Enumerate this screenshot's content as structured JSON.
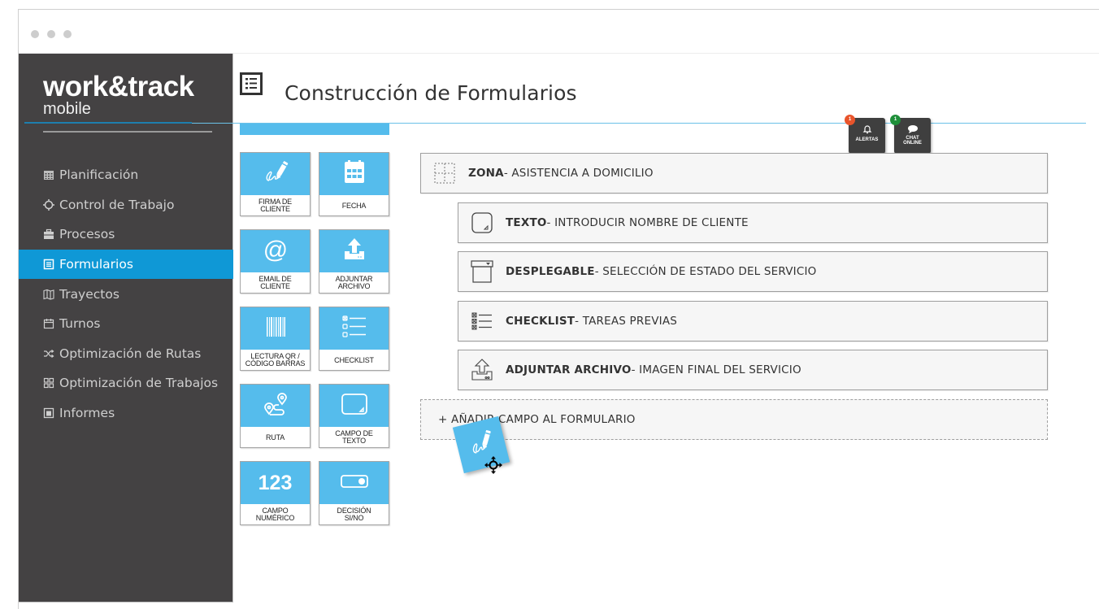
{
  "app": {
    "logo_main": "work&track",
    "logo_sub": "mobile"
  },
  "sidebar": {
    "items": [
      {
        "label": "Planificación",
        "icon": "calendar-grid-icon",
        "active": false
      },
      {
        "label": "Control de Trabajo",
        "icon": "crosshair-icon",
        "active": false
      },
      {
        "label": "Procesos",
        "icon": "briefcase-icon",
        "active": false
      },
      {
        "label": "Formularios",
        "icon": "form-list-icon",
        "active": true
      },
      {
        "label": "Trayectos",
        "icon": "map-icon",
        "active": false
      },
      {
        "label": "Turnos",
        "icon": "calendar-icon",
        "active": false
      },
      {
        "label": "Optimización de Rutas",
        "icon": "shuffle-icon",
        "active": false
      },
      {
        "label": "Optimización de Trabajos",
        "icon": "grid-icon",
        "active": false
      },
      {
        "label": "Informes",
        "icon": "report-icon",
        "active": false
      }
    ]
  },
  "header": {
    "title": "Construcción de Formularios",
    "icon": "form-list-icon"
  },
  "notifications": {
    "alerts": {
      "label": "ALERTAS",
      "count": "1",
      "badge_color": "#e8542b"
    },
    "chat": {
      "label_line1": "CHAT",
      "label_line2": "ONLINE",
      "count": "1",
      "badge_color": "#1f8f3a"
    }
  },
  "palette": {
    "tiles": [
      {
        "line1": "FIRMA DE",
        "line2": "CLIENTE",
        "icon": "signature-icon"
      },
      {
        "line1": "FECHA",
        "line2": "",
        "icon": "calendar-icon"
      },
      {
        "line1": "EMAIL DE",
        "line2": "CLIENTE",
        "icon": "at-sign-icon"
      },
      {
        "line1": "ADJUNTAR",
        "line2": "ARCHIVO",
        "icon": "upload-icon"
      },
      {
        "line1": "LECTURA QR /",
        "line2": "CÓDIGO BARRAS",
        "icon": "barcode-icon"
      },
      {
        "line1": "CHECKLIST",
        "line2": "",
        "icon": "checklist-icon"
      },
      {
        "line1": "RUTA",
        "line2": "",
        "icon": "route-icon"
      },
      {
        "line1": "CAMPO DE",
        "line2": "TEXTO",
        "icon": "text-field-icon"
      },
      {
        "line1": "CAMPO",
        "line2": "NUMÉRICO",
        "icon": "number-icon",
        "glyph": "123"
      },
      {
        "line1": "DECISIÓN",
        "line2": "SI/NO",
        "icon": "toggle-icon"
      }
    ]
  },
  "form": {
    "rows": [
      {
        "type": "ZONA",
        "desc": " - ASISTENCIA A DOMICILIO",
        "icon": "zone-icon"
      },
      {
        "type": "TEXTO",
        "desc": " - INTRODUCIR NOMBRE DE CLIENTE",
        "icon": "text-field-icon"
      },
      {
        "type": "DESPLEGABLE",
        "desc": " - SELECCIÓN DE ESTADO DEL SERVICIO",
        "icon": "dropdown-icon"
      },
      {
        "type": "CHECKLIST",
        "desc": " - TAREAS PREVIAS",
        "icon": "checklist-icon"
      },
      {
        "type": "ADJUNTAR ARCHIVO",
        "desc": " - IMAGEN FINAL DEL SERVICIO",
        "icon": "upload-icon"
      }
    ],
    "add_label": "+ AÑADIR CAMPO AL FORMULARIO"
  },
  "colors": {
    "accent": "#0f98d6",
    "tile_blue": "#55bcec",
    "sidebar_bg": "#444243"
  }
}
